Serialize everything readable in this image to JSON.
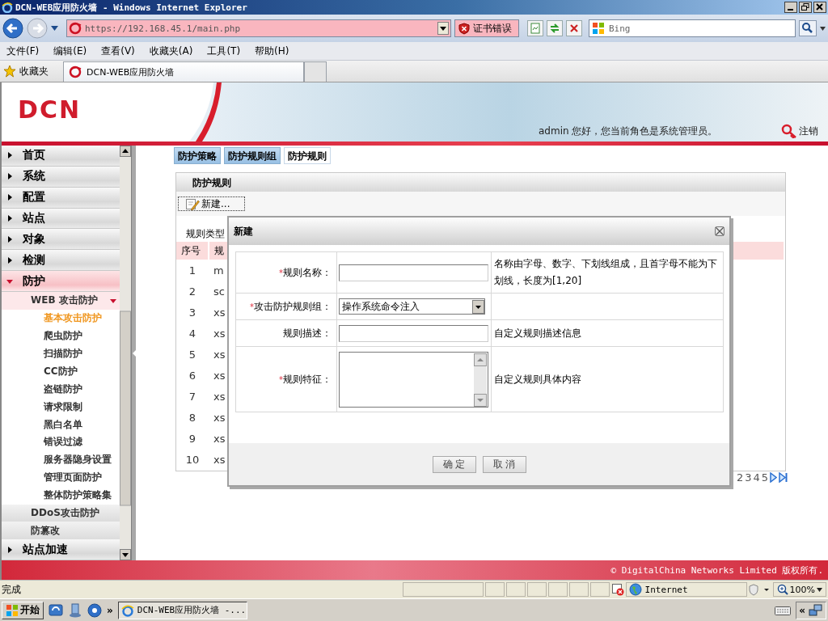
{
  "window": {
    "title": "DCN-WEB应用防火墙 - Windows Internet Explorer"
  },
  "address_bar": {
    "url": "https://192.168.45.1/main.php",
    "cert_error": "证书错误",
    "search_placeholder": "Bing"
  },
  "menu": [
    "文件(F)",
    "编辑(E)",
    "查看(V)",
    "收藏夹(A)",
    "工具(T)",
    "帮助(H)"
  ],
  "favorites": {
    "label": "收藏夹",
    "tab": "DCN-WEB应用防火墙"
  },
  "header": {
    "logo": "DCN",
    "greeting": "admin 您好，您当前角色是系统管理员。",
    "logout": "注销"
  },
  "sidebar": {
    "items": [
      {
        "label": "首页",
        "expanded": false
      },
      {
        "label": "系统",
        "expanded": false
      },
      {
        "label": "配置",
        "expanded": false
      },
      {
        "label": "站点",
        "expanded": false
      },
      {
        "label": "对象",
        "expanded": false
      },
      {
        "label": "检测",
        "expanded": false
      },
      {
        "label": "防护",
        "expanded": true,
        "children": [
          {
            "label": "WEB 攻击防护",
            "expanded": true,
            "children": [
              {
                "label": "基本攻击防护",
                "selected": true
              },
              {
                "label": "爬虫防护",
                "selected": false
              },
              {
                "label": "扫描防护",
                "selected": false
              },
              {
                "label": "CC防护",
                "selected": false
              },
              {
                "label": "盗链防护",
                "selected": false
              },
              {
                "label": "请求限制",
                "selected": false
              },
              {
                "label": "黑白名单",
                "selected": false
              },
              {
                "label": "错误过滤",
                "selected": false
              },
              {
                "label": "服务器隐身设置",
                "selected": false
              },
              {
                "label": "管理页面防护",
                "selected": false
              },
              {
                "label": "整体防护策略集",
                "selected": false
              }
            ]
          },
          {
            "label": "DDoS攻击防护",
            "expanded": false
          },
          {
            "label": "防篡改",
            "expanded": false
          }
        ]
      },
      {
        "label": "站点加速",
        "expanded": false
      }
    ]
  },
  "tabs": [
    {
      "label": "防护策略",
      "selected": false
    },
    {
      "label": "防护规则组",
      "selected": false
    },
    {
      "label": "防护规则",
      "selected": true
    }
  ],
  "panel": {
    "title": "防护规则",
    "new_button": "新建...",
    "filter_label": "规则类型",
    "table": {
      "columns": [
        "序号",
        "规"
      ],
      "rows": [
        [
          "1",
          "m"
        ],
        [
          "2",
          "sc"
        ],
        [
          "3",
          "xs"
        ],
        [
          "4",
          "xs"
        ],
        [
          "5",
          "xs"
        ],
        [
          "6",
          "xs"
        ],
        [
          "7",
          "xs"
        ],
        [
          "8",
          "xs"
        ],
        [
          "9",
          "xs"
        ],
        [
          "10",
          "xs"
        ]
      ]
    },
    "pages": [
      "2",
      "3",
      "4",
      "5"
    ]
  },
  "dialog": {
    "title": "新建",
    "required_mark": "*",
    "fields": [
      {
        "required": true,
        "label": "规则名称：",
        "kind": "text",
        "hint": "名称由字母、数字、下划线组成，且首字母不能为下划线，长度为[1,20]"
      },
      {
        "required": true,
        "label": "攻击防护规则组：",
        "kind": "select",
        "value": "操作系统命令注入"
      },
      {
        "required": false,
        "label": "规则描述：",
        "kind": "text",
        "hint": "自定义规则描述信息"
      },
      {
        "required": true,
        "label": "规则特征：",
        "kind": "textarea",
        "hint": "自定义规则具体内容"
      }
    ],
    "buttons": [
      "确 定",
      "取 消"
    ]
  },
  "footer": "© DigitalChina Networks Limited 版权所有.",
  "status_bar": {
    "text": "完成",
    "zone": "Internet",
    "zoom": "100%"
  },
  "taskbar": {
    "start": "开始",
    "more": "»",
    "window": "DCN-WEB应用防火墙 -...",
    "tray_more": "«"
  }
}
